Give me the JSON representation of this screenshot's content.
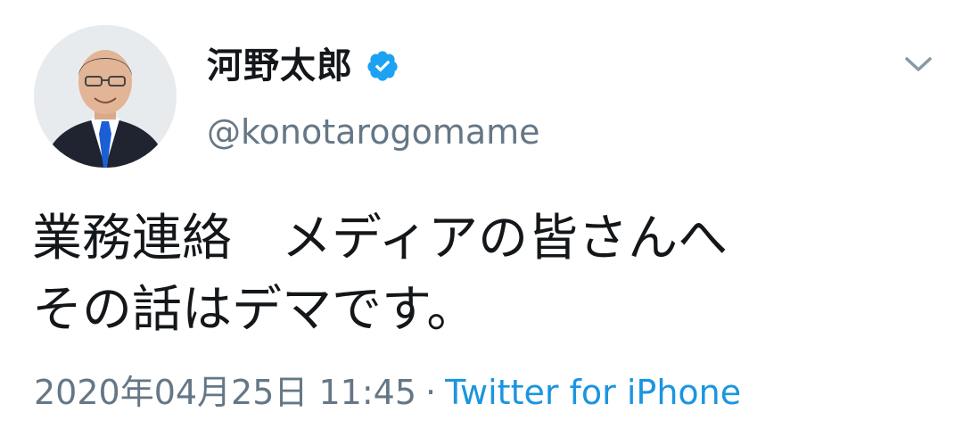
{
  "user": {
    "display_name": "河野太郎",
    "handle": "@konotarogomame",
    "verified": true,
    "avatar_icon": "profile-photo"
  },
  "tweet": {
    "line1": "業務連絡　メディアの皆さんへ",
    "line2": "その話はデマです。"
  },
  "meta": {
    "timestamp": "2020年04月25日 11:45",
    "separator": "·",
    "source": "Twitter for iPhone"
  },
  "icons": {
    "verified": "verified-badge-icon",
    "menu": "chevron-down-icon"
  },
  "colors": {
    "text": "#14171a",
    "secondary": "#657786",
    "link": "#1b95e0",
    "verified": "#1da1f2"
  }
}
